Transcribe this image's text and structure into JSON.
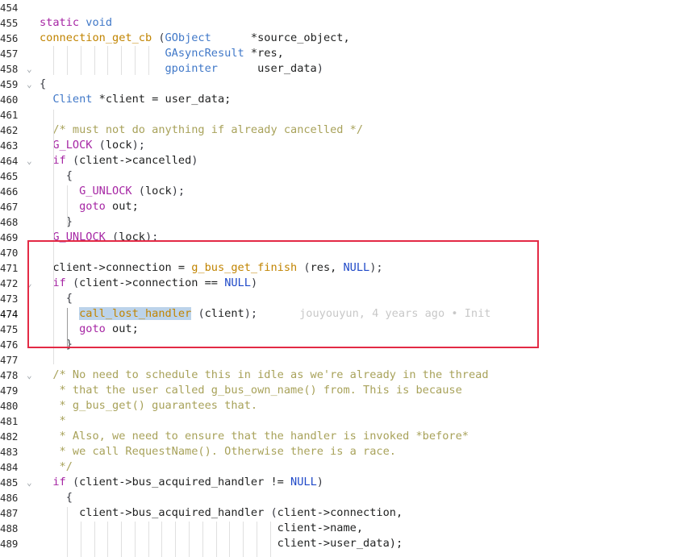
{
  "editor": {
    "lines": [
      {
        "n": "454",
        "fold": false,
        "tokens": []
      },
      {
        "n": "455",
        "fold": false,
        "tokens": [
          [
            "kw",
            "static"
          ],
          [
            "var",
            " "
          ],
          [
            "type",
            "void"
          ]
        ]
      },
      {
        "n": "456",
        "fold": false,
        "tokens": [
          [
            "fn",
            "connection_get_cb"
          ],
          [
            "var",
            " "
          ],
          [
            "punc",
            "("
          ],
          [
            "type",
            "GObject"
          ],
          [
            "var",
            "      *source_object,"
          ]
        ]
      },
      {
        "n": "457",
        "fold": false,
        "tokens": [
          [
            "var",
            "                   "
          ],
          [
            "type",
            "GAsyncResult"
          ],
          [
            "var",
            " *res,"
          ]
        ]
      },
      {
        "n": "458",
        "fold": true,
        "tokens": [
          [
            "var",
            "                   "
          ],
          [
            "type",
            "gpointer"
          ],
          [
            "var",
            "      user_data"
          ],
          [
            "punc",
            ")"
          ]
        ]
      },
      {
        "n": "459",
        "fold": true,
        "tokens": [
          [
            "punc",
            "{"
          ]
        ]
      },
      {
        "n": "460",
        "fold": false,
        "tokens": [
          [
            "var",
            "  "
          ],
          [
            "type",
            "Client"
          ],
          [
            "var",
            " *client = user_data;"
          ]
        ]
      },
      {
        "n": "461",
        "fold": false,
        "tokens": []
      },
      {
        "n": "462",
        "fold": false,
        "tokens": [
          [
            "var",
            "  "
          ],
          [
            "com",
            "/* must not do anything if already cancelled */"
          ]
        ]
      },
      {
        "n": "463",
        "fold": false,
        "tokens": [
          [
            "var",
            "  "
          ],
          [
            "mac",
            "G_LOCK"
          ],
          [
            "var",
            " "
          ],
          [
            "punc",
            "("
          ],
          [
            "var",
            "lock"
          ],
          [
            "punc",
            ");"
          ]
        ]
      },
      {
        "n": "464",
        "fold": true,
        "tokens": [
          [
            "var",
            "  "
          ],
          [
            "kw",
            "if"
          ],
          [
            "var",
            " "
          ],
          [
            "punc",
            "("
          ],
          [
            "var",
            "client->cancelled"
          ],
          [
            "punc",
            ")"
          ]
        ]
      },
      {
        "n": "465",
        "fold": false,
        "tokens": [
          [
            "var",
            "    "
          ],
          [
            "punc",
            "{"
          ]
        ]
      },
      {
        "n": "466",
        "fold": false,
        "tokens": [
          [
            "var",
            "      "
          ],
          [
            "mac",
            "G_UNLOCK"
          ],
          [
            "var",
            " "
          ],
          [
            "punc",
            "("
          ],
          [
            "var",
            "lock"
          ],
          [
            "punc",
            ");"
          ]
        ]
      },
      {
        "n": "467",
        "fold": false,
        "tokens": [
          [
            "var",
            "      "
          ],
          [
            "kw",
            "goto"
          ],
          [
            "var",
            " out;"
          ]
        ]
      },
      {
        "n": "468",
        "fold": false,
        "tokens": [
          [
            "var",
            "    "
          ],
          [
            "punc",
            "}"
          ]
        ]
      },
      {
        "n": "469",
        "fold": false,
        "tokens": [
          [
            "var",
            "  "
          ],
          [
            "mac",
            "G_UNLOCK"
          ],
          [
            "var",
            " "
          ],
          [
            "punc",
            "("
          ],
          [
            "var",
            "lock"
          ],
          [
            "punc",
            ");"
          ]
        ]
      },
      {
        "n": "470",
        "fold": false,
        "tokens": []
      },
      {
        "n": "471",
        "fold": false,
        "tokens": [
          [
            "var",
            "  client->connection = "
          ],
          [
            "fn",
            "g_bus_get_finish"
          ],
          [
            "var",
            " "
          ],
          [
            "punc",
            "("
          ],
          [
            "var",
            "res, "
          ],
          [
            "const",
            "NULL"
          ],
          [
            "punc",
            ");"
          ]
        ]
      },
      {
        "n": "472",
        "fold": true,
        "tokens": [
          [
            "var",
            "  "
          ],
          [
            "kw",
            "if"
          ],
          [
            "var",
            " "
          ],
          [
            "punc",
            "("
          ],
          [
            "var",
            "client->connection == "
          ],
          [
            "const",
            "NULL"
          ],
          [
            "punc",
            ")"
          ]
        ]
      },
      {
        "n": "473",
        "fold": false,
        "tokens": [
          [
            "var",
            "    "
          ],
          [
            "punc",
            "{"
          ]
        ]
      },
      {
        "n": "474",
        "fold": false,
        "tokens": [
          [
            "var",
            "      "
          ],
          [
            "hlfn",
            "call_lost_handler"
          ],
          [
            "var",
            " "
          ],
          [
            "punc",
            "("
          ],
          [
            "var",
            "client"
          ],
          [
            "punc",
            ");"
          ],
          [
            "blame",
            "jouyouyun, 4 years ago • Init"
          ]
        ]
      },
      {
        "n": "475",
        "fold": false,
        "tokens": [
          [
            "var",
            "      "
          ],
          [
            "kw",
            "goto"
          ],
          [
            "var",
            " out;"
          ]
        ]
      },
      {
        "n": "476",
        "fold": false,
        "tokens": [
          [
            "var",
            "    "
          ],
          [
            "punc",
            "}"
          ]
        ]
      },
      {
        "n": "477",
        "fold": false,
        "tokens": []
      },
      {
        "n": "478",
        "fold": true,
        "tokens": [
          [
            "var",
            "  "
          ],
          [
            "com",
            "/* No need to schedule this in idle as we're already in the thread"
          ]
        ]
      },
      {
        "n": "479",
        "fold": false,
        "tokens": [
          [
            "com",
            "   * that the user called g_bus_own_name() from. This is because"
          ]
        ]
      },
      {
        "n": "480",
        "fold": false,
        "tokens": [
          [
            "com",
            "   * g_bus_get() guarantees that."
          ]
        ]
      },
      {
        "n": "481",
        "fold": false,
        "tokens": [
          [
            "com",
            "   *"
          ]
        ]
      },
      {
        "n": "482",
        "fold": false,
        "tokens": [
          [
            "com",
            "   * Also, we need to ensure that the handler is invoked *before*"
          ]
        ]
      },
      {
        "n": "483",
        "fold": false,
        "tokens": [
          [
            "com",
            "   * we call RequestName(). Otherwise there is a race."
          ]
        ]
      },
      {
        "n": "484",
        "fold": false,
        "tokens": [
          [
            "com",
            "   */"
          ]
        ]
      },
      {
        "n": "485",
        "fold": true,
        "tokens": [
          [
            "var",
            "  "
          ],
          [
            "kw",
            "if"
          ],
          [
            "var",
            " "
          ],
          [
            "punc",
            "("
          ],
          [
            "var",
            "client->bus_acquired_handler != "
          ],
          [
            "const",
            "NULL"
          ],
          [
            "punc",
            ")"
          ]
        ]
      },
      {
        "n": "486",
        "fold": false,
        "tokens": [
          [
            "var",
            "    "
          ],
          [
            "punc",
            "{"
          ]
        ]
      },
      {
        "n": "487",
        "fold": false,
        "tokens": [
          [
            "var",
            "      client->bus_acquired_handler "
          ],
          [
            "punc",
            "("
          ],
          [
            "var",
            "client->connection,"
          ]
        ]
      },
      {
        "n": "488",
        "fold": false,
        "tokens": [
          [
            "var",
            "                                    client->name,"
          ]
        ]
      },
      {
        "n": "489",
        "fold": false,
        "tokens": [
          [
            "var",
            "                                    client->user_data);"
          ]
        ]
      }
    ],
    "active_line": "474"
  },
  "colors": {
    "keyword": "#a626a4",
    "type": "#4078c8",
    "function": "#c18401",
    "comment": "#a8a25a",
    "constant": "#1f49c8",
    "highlight_box": "#e32a45",
    "selection": "#bcd3ea",
    "blame_text": "#c8c8c8"
  },
  "icons": {
    "fold": "chevron-down-icon"
  }
}
